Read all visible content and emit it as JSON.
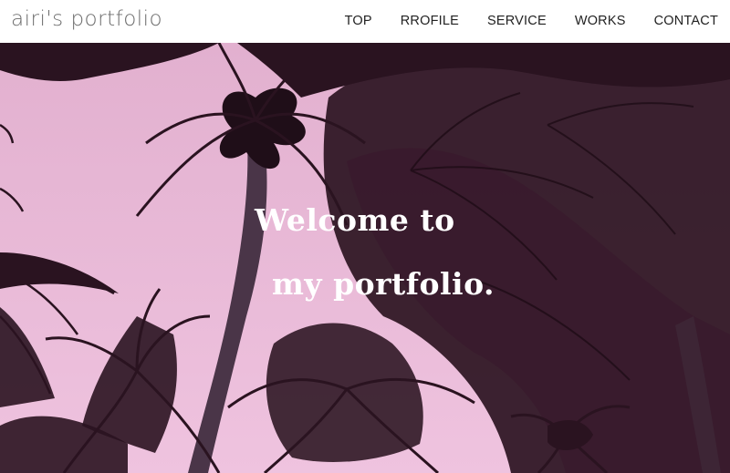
{
  "header": {
    "logo": "airi's portfolio",
    "nav": [
      "TOP",
      "RROFILE",
      "SERVICE",
      "WORKS",
      "CONTACT"
    ]
  },
  "hero": {
    "line1": "Welcome to",
    "line2": "my portfolio."
  },
  "colors": {
    "sky": "#e8b8d6",
    "palm": "#2a1420",
    "header_bg": "#ffffff"
  }
}
